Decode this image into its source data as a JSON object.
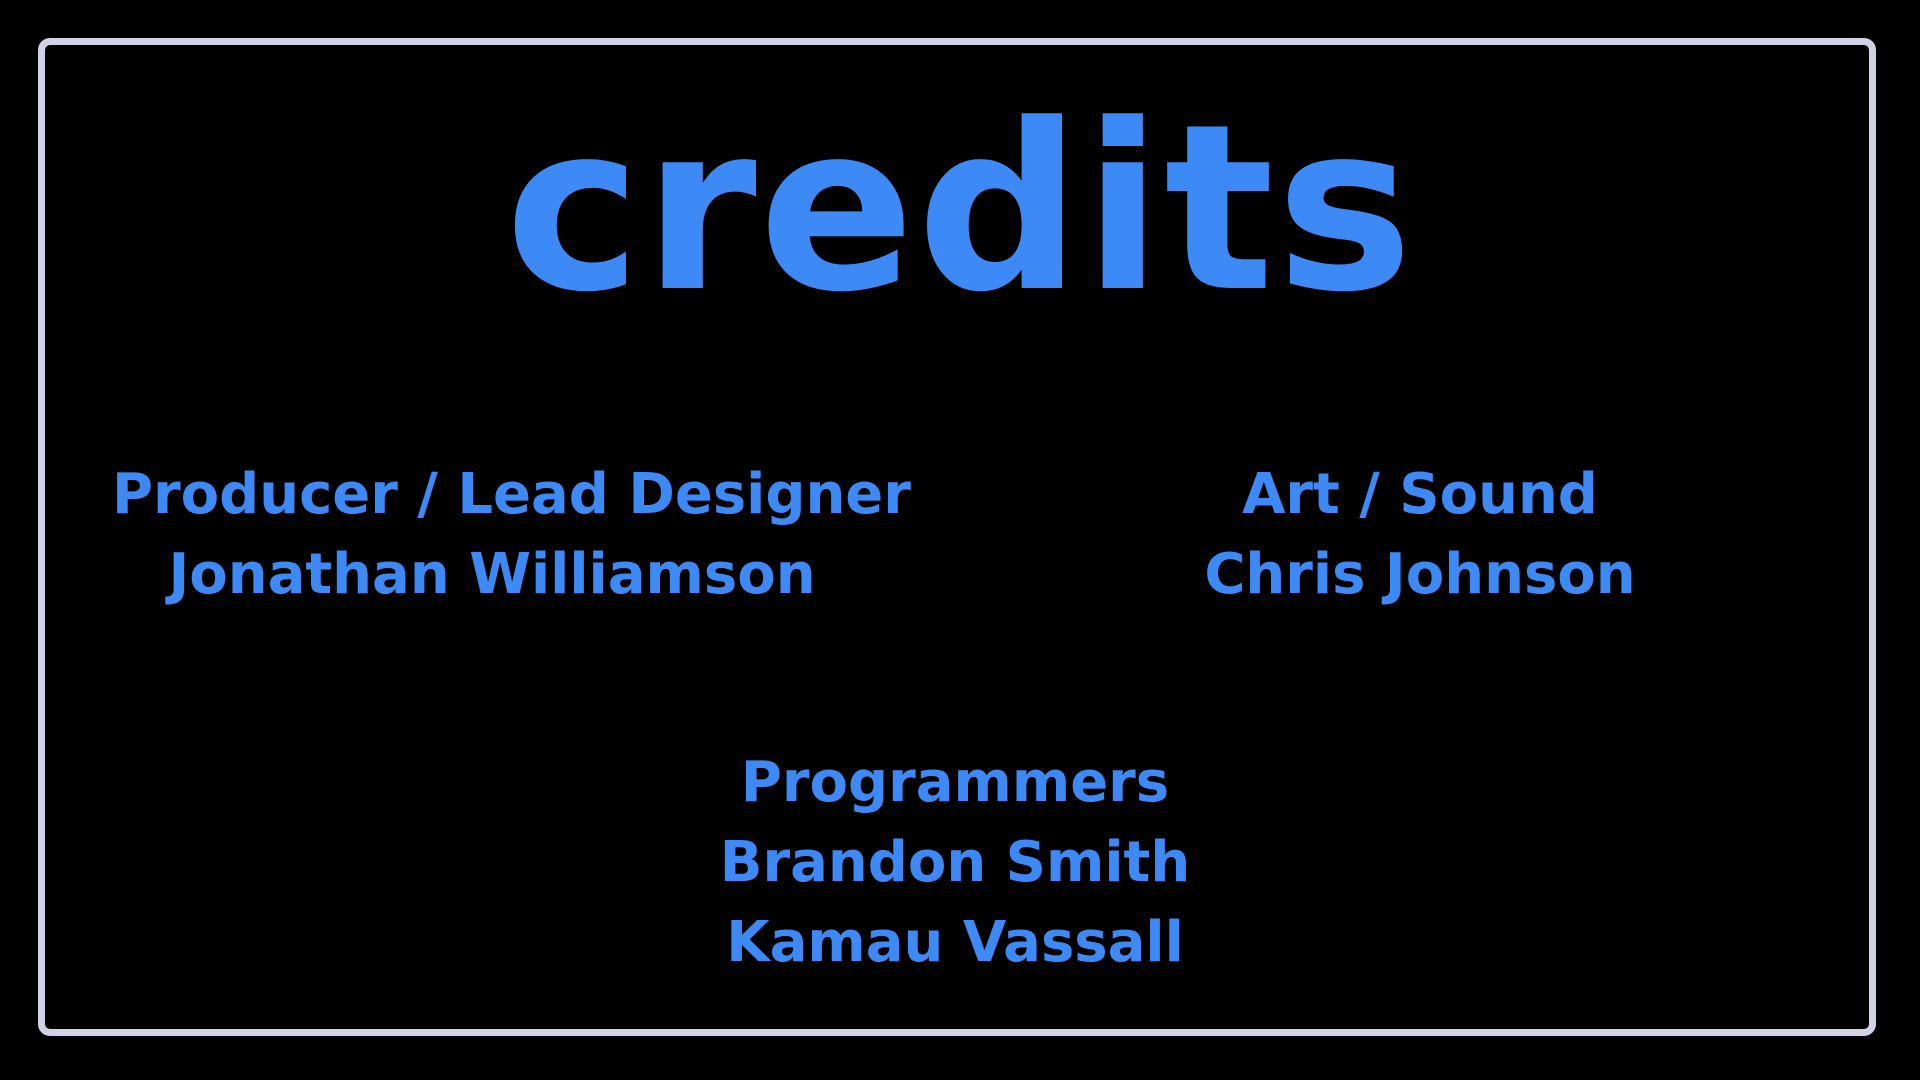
{
  "screen": {
    "title": "credits",
    "accent_color": "#3d8af7",
    "frame_color": "#d2d2e6",
    "background_color": "#000000"
  },
  "credits": {
    "producer": {
      "role": "Producer / Lead Designer",
      "names": [
        "Jonathan Williamson"
      ]
    },
    "art": {
      "role": "Art / Sound",
      "names": [
        "Chris Johnson"
      ]
    },
    "programmers": {
      "role": "Programmers",
      "names": [
        "Brandon Smith",
        "Kamau Vassall"
      ]
    }
  }
}
